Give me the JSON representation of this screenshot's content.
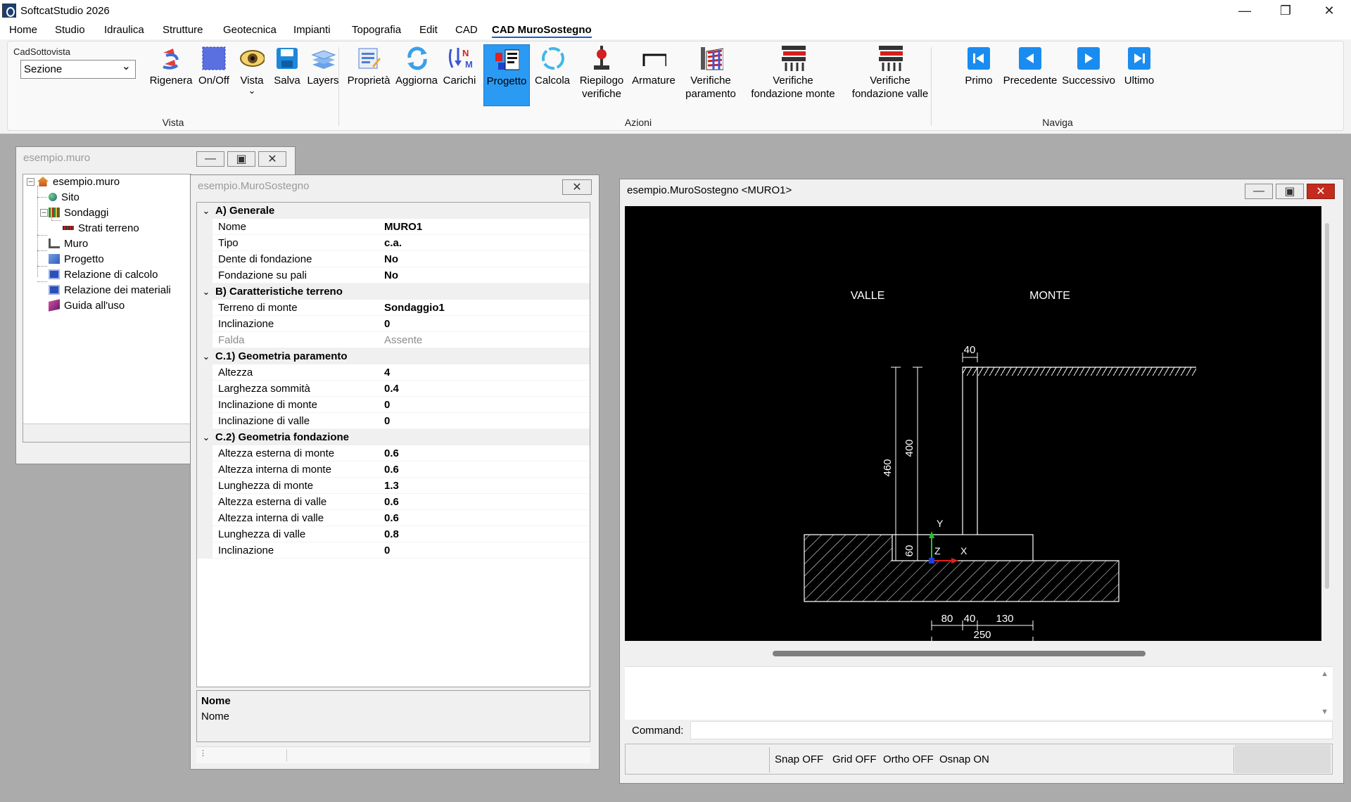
{
  "app": {
    "title": "SoftcatStudio 2026"
  },
  "menu": [
    "Home",
    "Studio",
    "Idraulica",
    "Strutture",
    "Geotecnica",
    "Impianti",
    "Topografia",
    "Edit",
    "CAD",
    "CAD MuroSostegno"
  ],
  "ribbon": {
    "subview_label": "CadSottovista",
    "subview_value": "Sezione",
    "groups": {
      "vista": "Vista",
      "azioni": "Azioni",
      "naviga": "Naviga"
    },
    "vista_buttons": [
      "Rigenera",
      "On/Off",
      "Vista",
      "Salva",
      "Layers"
    ],
    "azioni_buttons": [
      "Proprietà",
      "Aggiorna",
      "Carichi",
      "Progetto",
      "Calcola",
      "Riepilogo\nverifiche",
      "Armature",
      "Verifiche\nparamento",
      "Verifiche\nfondazione monte",
      "Verifiche\nfondazione valle"
    ],
    "naviga_buttons": [
      "Primo",
      "Precedente",
      "Successivo",
      "Ultimo"
    ],
    "colors": {
      "pressed": "#2b9af3",
      "nav_blue": "#1a8cf0"
    }
  },
  "tree_window": {
    "title": "esempio.muro",
    "nodes": [
      "esempio.muro",
      "Sito",
      "Sondaggi",
      "Strati terreno",
      "Muro",
      "Progetto",
      "Relazione di calcolo",
      "Relazione dei materiali",
      "Guida all'uso"
    ]
  },
  "prop_window": {
    "title": "esempio.MuroSostegno",
    "categories": {
      "a": "A) Generale",
      "b": "B) Caratteristiche terreno",
      "c1": "C.1) Geometria paramento",
      "c2": "C.2) Geometria fondazione"
    },
    "rows": {
      "a": [
        [
          "Nome",
          "MURO1"
        ],
        [
          "Tipo",
          "c.a."
        ],
        [
          "Dente di fondazione",
          "No"
        ],
        [
          "Fondazione su pali",
          "No"
        ]
      ],
      "b": [
        [
          "Terreno di monte",
          "Sondaggio1"
        ],
        [
          "Inclinazione",
          "0"
        ],
        [
          "Falda",
          "Assente"
        ]
      ],
      "c1": [
        [
          "Altezza",
          "4"
        ],
        [
          "Larghezza sommità",
          "0.4"
        ],
        [
          "Inclinazione di monte",
          "0"
        ],
        [
          "Inclinazione di valle",
          "0"
        ]
      ],
      "c2": [
        [
          "Altezza esterna di monte",
          "0.6"
        ],
        [
          "Altezza interna di monte",
          "0.6"
        ],
        [
          "Lunghezza di monte",
          "1.3"
        ],
        [
          "Altezza esterna di valle",
          "0.6"
        ],
        [
          "Altezza interna di valle",
          "0.6"
        ],
        [
          "Lunghezza di valle",
          "0.8"
        ],
        [
          "Inclinazione",
          "0"
        ]
      ]
    },
    "help_title": "Nome",
    "help_text": "Nome"
  },
  "cad_window": {
    "title": "esempio.MuroSostegno <MURO1>",
    "labels": {
      "valle": "VALLE",
      "monte": "MONTE"
    },
    "dims": {
      "top": "40",
      "h_total": "460",
      "h_wall": "400",
      "h_found": "60",
      "d_valle": "80",
      "d_wall": "40",
      "d_monte": "130",
      "d_total": "250"
    },
    "axes": {
      "x": "X",
      "y": "Y",
      "z": "Z"
    },
    "command_label": "Command:",
    "status": [
      "Snap OFF",
      "Grid OFF",
      "Ortho OFF",
      "Osnap ON"
    ]
  }
}
